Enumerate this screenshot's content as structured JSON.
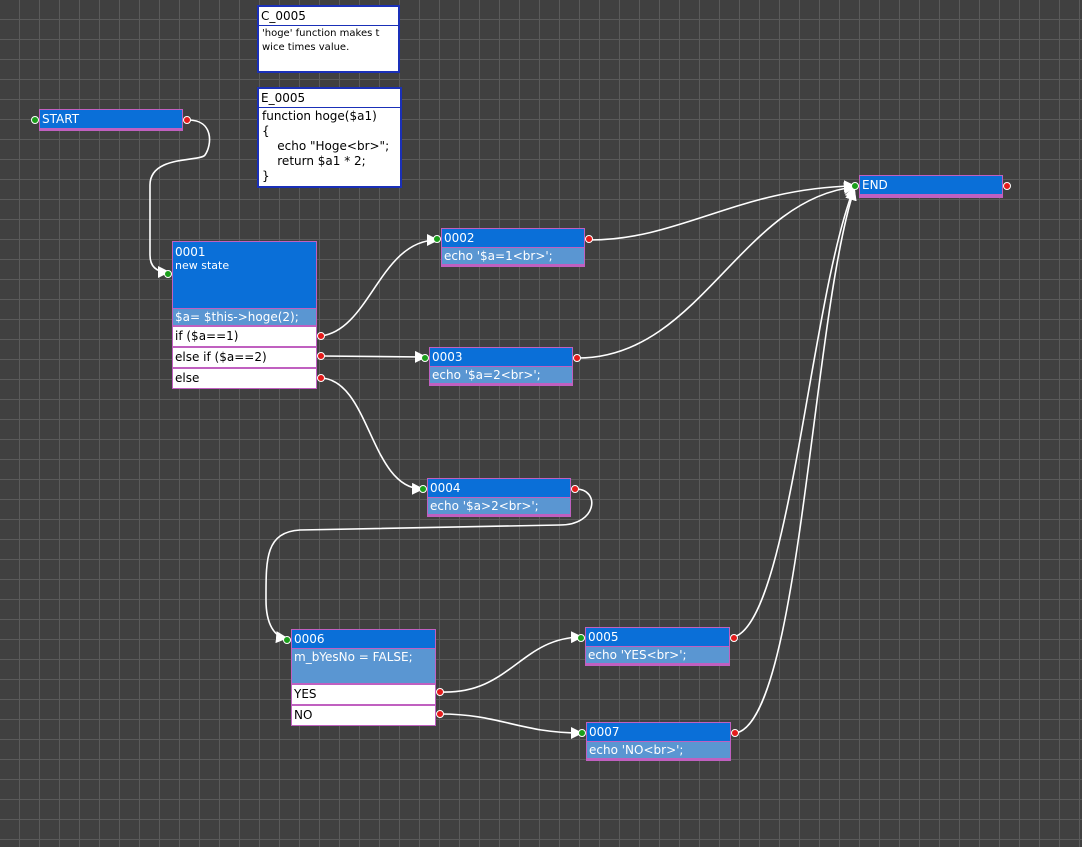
{
  "colors": {
    "node_header": "#0a6fd8",
    "node_sub": "#5a96d2",
    "node_border": "#c060c0",
    "note_border": "#1a30b8",
    "port_in": "#1b9e1b",
    "port_out": "#e41b1b",
    "wire": "#ffffff"
  },
  "notes": {
    "comment": {
      "title": "C_0005",
      "body": "'hoge' function makes t\nwice times value."
    },
    "embed": {
      "title": "E_0005",
      "body": "function hoge($a1)\n{\n    echo \"Hoge<br>\";\n    return $a1 * 2;\n}"
    }
  },
  "nodes": {
    "start": {
      "label": "START"
    },
    "end": {
      "label": "END"
    },
    "n0001": {
      "id": "0001",
      "desc": "new state",
      "action": "$a= $this->hoge(2);",
      "branches": [
        "if ($a==1)",
        "else if ($a==2)",
        "else"
      ]
    },
    "n0002": {
      "id": "0002",
      "action": "echo '$a=1<br>';"
    },
    "n0003": {
      "id": "0003",
      "action": "echo '$a=2<br>';"
    },
    "n0004": {
      "id": "0004",
      "action": "echo '$a>2<br>';"
    },
    "n0006": {
      "id": "0006",
      "action": "m_bYesNo = FALSE;",
      "branches": [
        "YES",
        "NO"
      ]
    },
    "n0005": {
      "id": "0005",
      "action": "echo 'YES<br>';"
    },
    "n0007": {
      "id": "0007",
      "action": "echo 'NO<br>';"
    }
  }
}
